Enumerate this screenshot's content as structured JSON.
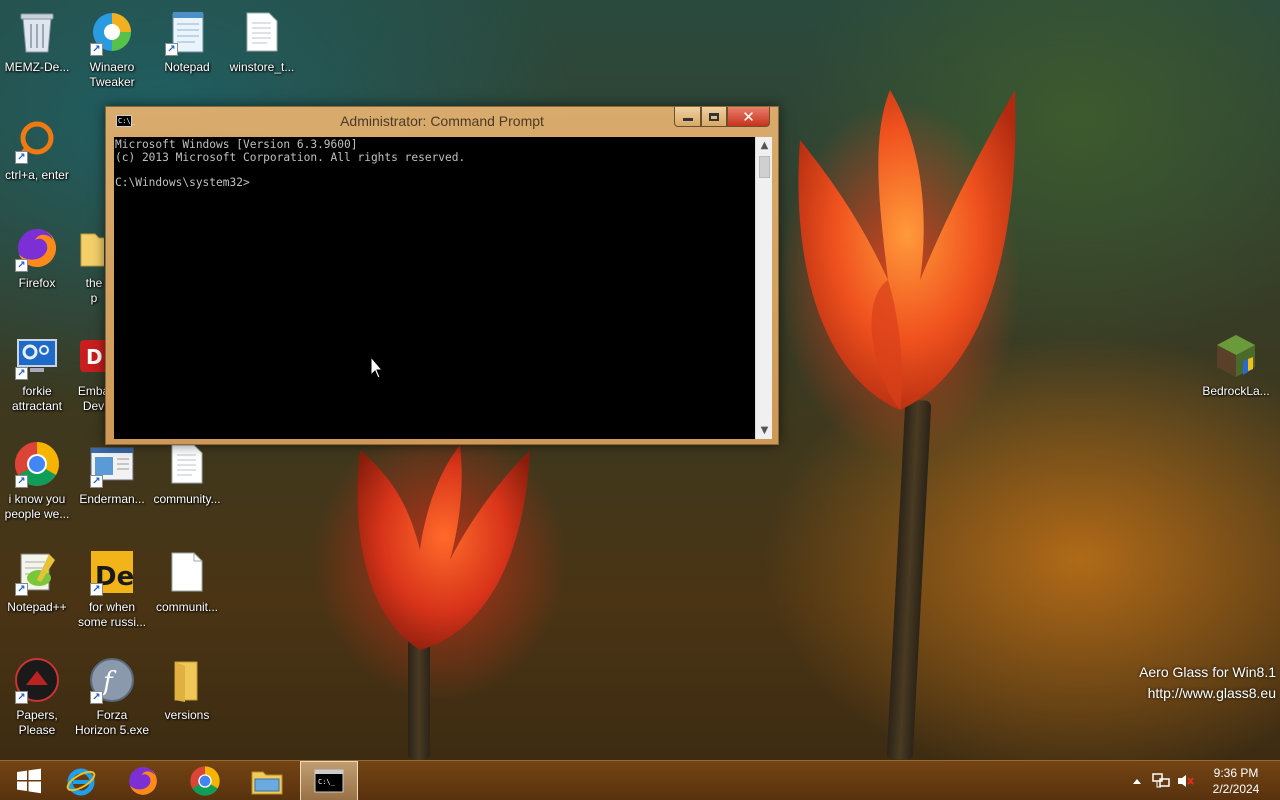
{
  "desktop": {
    "icons": [
      {
        "label": "MEMZ-De...",
        "icon": "recycle-bin-icon"
      },
      {
        "label": "Winaero\nTweaker",
        "icon": "winaero-tweaker-icon"
      },
      {
        "label": "Notepad",
        "icon": "notepad-icon"
      },
      {
        "label": "winstore_t...",
        "icon": "text-file-icon"
      },
      {
        "label": "ctrl+a, enter",
        "icon": "orange-app-icon"
      },
      {
        "label": "Firefox",
        "icon": "firefox-icon"
      },
      {
        "label": "the p",
        "icon": "folder-icon"
      },
      {
        "label": "forkie\nattractant",
        "icon": "settings-monitor-icon"
      },
      {
        "label": "Emba\nDev",
        "icon": "embarcadero-icon"
      },
      {
        "label": "i know you\npeople we...",
        "icon": "chrome-icon"
      },
      {
        "label": "Enderman...",
        "icon": "app-window-icon"
      },
      {
        "label": "community...",
        "icon": "text-file-icon"
      },
      {
        "label": "Notepad++",
        "icon": "notepad-plus-plus-icon"
      },
      {
        "label": "for when\nsome russi...",
        "icon": "delphi-icon"
      },
      {
        "label": "communit...",
        "icon": "blank-file-icon"
      },
      {
        "label": "Papers,\nPlease",
        "icon": "papers-please-icon"
      },
      {
        "label": "Forza\nHorizon 5.exe",
        "icon": "flash-icon"
      },
      {
        "label": "versions",
        "icon": "folder-icon"
      },
      {
        "label": "BedrockLa...",
        "icon": "minecraft-launcher-icon"
      }
    ]
  },
  "cmd": {
    "title": "Administrator: Command Prompt",
    "app_icon_text": "C:\\_",
    "lines": "Microsoft Windows [Version 6.3.9600]\n(c) 2013 Microsoft Corporation. All rights reserved.\n\nC:\\Windows\\system32>",
    "close_symbol": "✕"
  },
  "watermark": {
    "line1": "Aero Glass for Win8.1",
    "line2": "http://www.glass8.eu"
  },
  "taskbar": {
    "pinned": [
      "start-button",
      "internet-explorer",
      "firefox",
      "chrome",
      "file-explorer",
      "command-prompt"
    ],
    "active": "command-prompt"
  },
  "clock": {
    "time": "9:36 PM",
    "date": "2/2/2024"
  },
  "colors": {
    "taskbar": "#6a3c12",
    "window_frame": "#dcaa6c",
    "console_bg": "#000000",
    "console_text": "#c0c0c0"
  }
}
